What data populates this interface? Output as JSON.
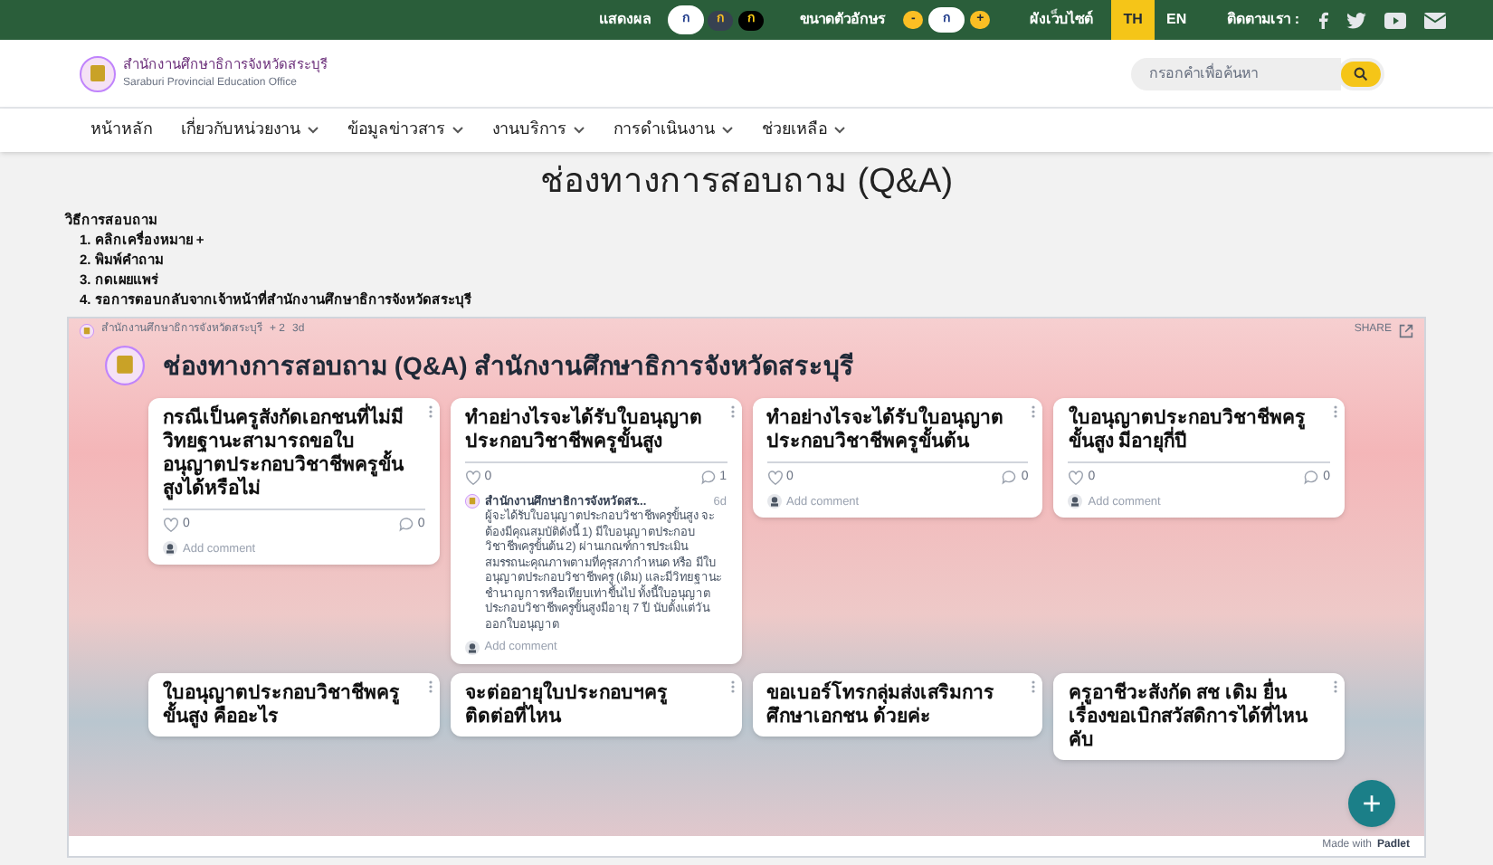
{
  "top_bar": {
    "contrast_label": "แสดงผล",
    "contrast_options": [
      {
        "label": "ก",
        "selected": true
      },
      {
        "label": "ก",
        "selected": false
      },
      {
        "label": "ก",
        "selected": false
      }
    ],
    "font_size_label": "ขนาดตัวอักษร",
    "font_size_options": [
      {
        "label": "-",
        "selected": false
      },
      {
        "label": "ก",
        "selected": true
      },
      {
        "label": "+",
        "selected": false
      }
    ],
    "sitemap": "ผังเว็บไซต์",
    "languages": [
      {
        "label": "TH",
        "selected": true
      },
      {
        "label": "EN",
        "selected": false
      }
    ],
    "follow_label": "ติดตามเรา :"
  },
  "header": {
    "org_name": "สำนักงานศึกษาธิการจังหวัดสระบุรี",
    "org_name_en": "Saraburi Provincial Education Office",
    "search": {
      "placeholder": "กรอกคำเพื่อค้นหา"
    }
  },
  "nav": [
    {
      "label": "หน้าหลัก",
      "dropdown": false
    },
    {
      "label": "เกี่ยวกับหน่วยงาน",
      "dropdown": true
    },
    {
      "label": "ข้อมูลข่าวสาร",
      "dropdown": true
    },
    {
      "label": "งานบริการ",
      "dropdown": true
    },
    {
      "label": "การดำเนินงาน",
      "dropdown": true
    },
    {
      "label": "ช่วยเหลือ",
      "dropdown": true
    }
  ],
  "page_title": "ช่องทางการสอบถาม (Q&A)",
  "instructions": {
    "heading": "วิธีการสอบถาม",
    "steps": [
      "1. คลิกเครื่องหมาย +",
      "2. พิมพ์คำถาม",
      "3. กดเผยแพร่",
      "4. รอการตอบกลับจากเจ้าหน้าที่สำนักงานศึกษาธิการจังหวัดสระบุรี"
    ]
  },
  "padlet": {
    "owner": "สำนักงานศึกษาธิการจังหวัดสระบุรี",
    "likes": "+ 2",
    "age": "3d",
    "share": "SHARE",
    "title": "ช่องทางการสอบถาม (Q&A) สำนักงานศึกษาธิการจังหวัดสระบุรี",
    "posts": [
      {
        "title": "กรณีเป็นครูสังกัดเอกชนที่ไม่มีวิทยฐานะสามารถขอใบอนุญาตประกอบวิชาชีพครูขั้นสูงได้หรือไม่",
        "likes": "0",
        "comments": "0",
        "add_comment": "Add comment"
      },
      {
        "title": "ทำอย่างไรจะได้รับใบอนุญาตประกอบวิชาชีพครูขั้นสูง",
        "likes": "0",
        "comments": "1",
        "reply": {
          "author": "สำนักงานศึกษาธิการจังหวัดสร...",
          "age": "6d",
          "text": "ผู้จะได้รับใบอนุญาตประกอบวิชาชีพครูขั้นสูง จะต้องมีคุณสมบัติดังนี้ 1) มีใบอนุญาตประกอบวิชาชีพครูขั้นต้น 2) ผ่านเกณฑ์การประเมินสมรรถนะคุณภาพตามที่คุรุสภากำหนด หรือ มีใบอนุญาตประกอบวิชาชีพครู (เดิม) และมีวิทยฐานะชำนาญการหรือเทียบเท่าขึ้นไป ทั้งนี้ใบอนุญาตประกอบวิชาชีพครูขั้นสูงมีอายุ 7 ปี นับตั้งแต่วันออกใบอนุญาต"
        },
        "add_comment": "Add comment"
      },
      {
        "title": "ทำอย่างไรจะได้รับใบอนุญาตประกอบวิชาชีพครูขั้นต้น",
        "likes": "0",
        "comments": "0",
        "add_comment": "Add comment"
      },
      {
        "title": "ใบอนุญาตประกอบวิชาชีพครูขั้นสูง มีอายุกี่ปี",
        "likes": "0",
        "comments": "0",
        "add_comment": "Add comment"
      },
      {
        "title": "ใบอนุญาตประกอบวิชาชีพครูขั้นสูง คืออะไร"
      },
      {
        "title": "จะต่ออายุใบประกอบฯครู ติดต่อที่ไหน"
      },
      {
        "title": "ขอเบอร์โทรกลุ่มส่งเสริมการศึกษาเอกชน ด้วยค่ะ"
      },
      {
        "title": "ครูอาชีวะสังกัด สช เดิม ยื่นเรื่องขอเบิกสวัสดิการได้ที่ไหนคับ"
      }
    ],
    "add_button": "+",
    "made_with": "Made with",
    "brand": "Padlet"
  }
}
